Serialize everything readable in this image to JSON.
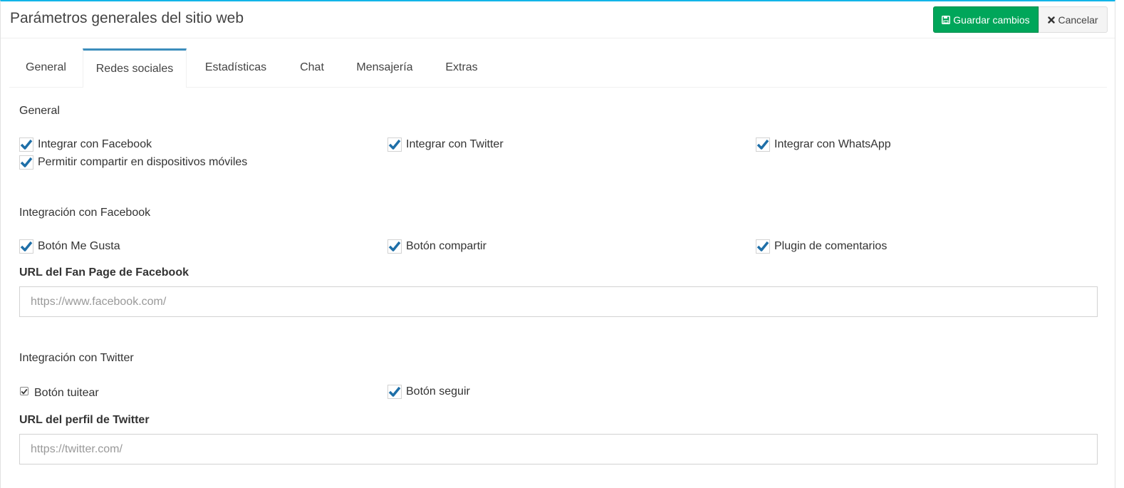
{
  "header": {
    "title": "Parámetros generales del sitio web",
    "save_label": "Guardar cambios",
    "cancel_label": "Cancelar",
    "save_icon": "floppy-disk-icon",
    "cancel_icon": "close-icon"
  },
  "tabs": [
    {
      "label": "General",
      "active": false
    },
    {
      "label": "Redes sociales",
      "active": true
    },
    {
      "label": "Estadísticas",
      "active": false
    },
    {
      "label": "Chat",
      "active": false
    },
    {
      "label": "Mensajería",
      "active": false
    },
    {
      "label": "Extras",
      "active": false
    }
  ],
  "sections": {
    "general": {
      "title": "General",
      "options": [
        {
          "label": "Integrar con Facebook",
          "checked": true
        },
        {
          "label": "Integrar con Twitter",
          "checked": true
        },
        {
          "label": "Integrar con WhatsApp",
          "checked": true
        },
        {
          "label": "Permitir compartir en dispositivos móviles",
          "checked": true
        }
      ]
    },
    "facebook": {
      "title": "Integración con Facebook",
      "options": [
        {
          "label": "Botón Me Gusta",
          "checked": true
        },
        {
          "label": "Botón compartir",
          "checked": true
        },
        {
          "label": "Plugin de comentarios",
          "checked": true
        }
      ],
      "url_label": "URL del Fan Page de Facebook",
      "url_value": "",
      "url_placeholder": "https://www.facebook.com/"
    },
    "twitter": {
      "title": "Integración con Twitter",
      "options": [
        {
          "label": "Botón tuitear",
          "checked": true
        },
        {
          "label": "Botón seguir",
          "checked": true
        }
      ],
      "url_label": "URL del perfil de Twitter",
      "url_value": "",
      "url_placeholder": "https://twitter.com/"
    }
  },
  "colors": {
    "accent_top": "#12b5e8",
    "save_button": "#00a65a",
    "tab_active_border": "#3c8dbc",
    "checkmark": "#1e6fa8"
  }
}
